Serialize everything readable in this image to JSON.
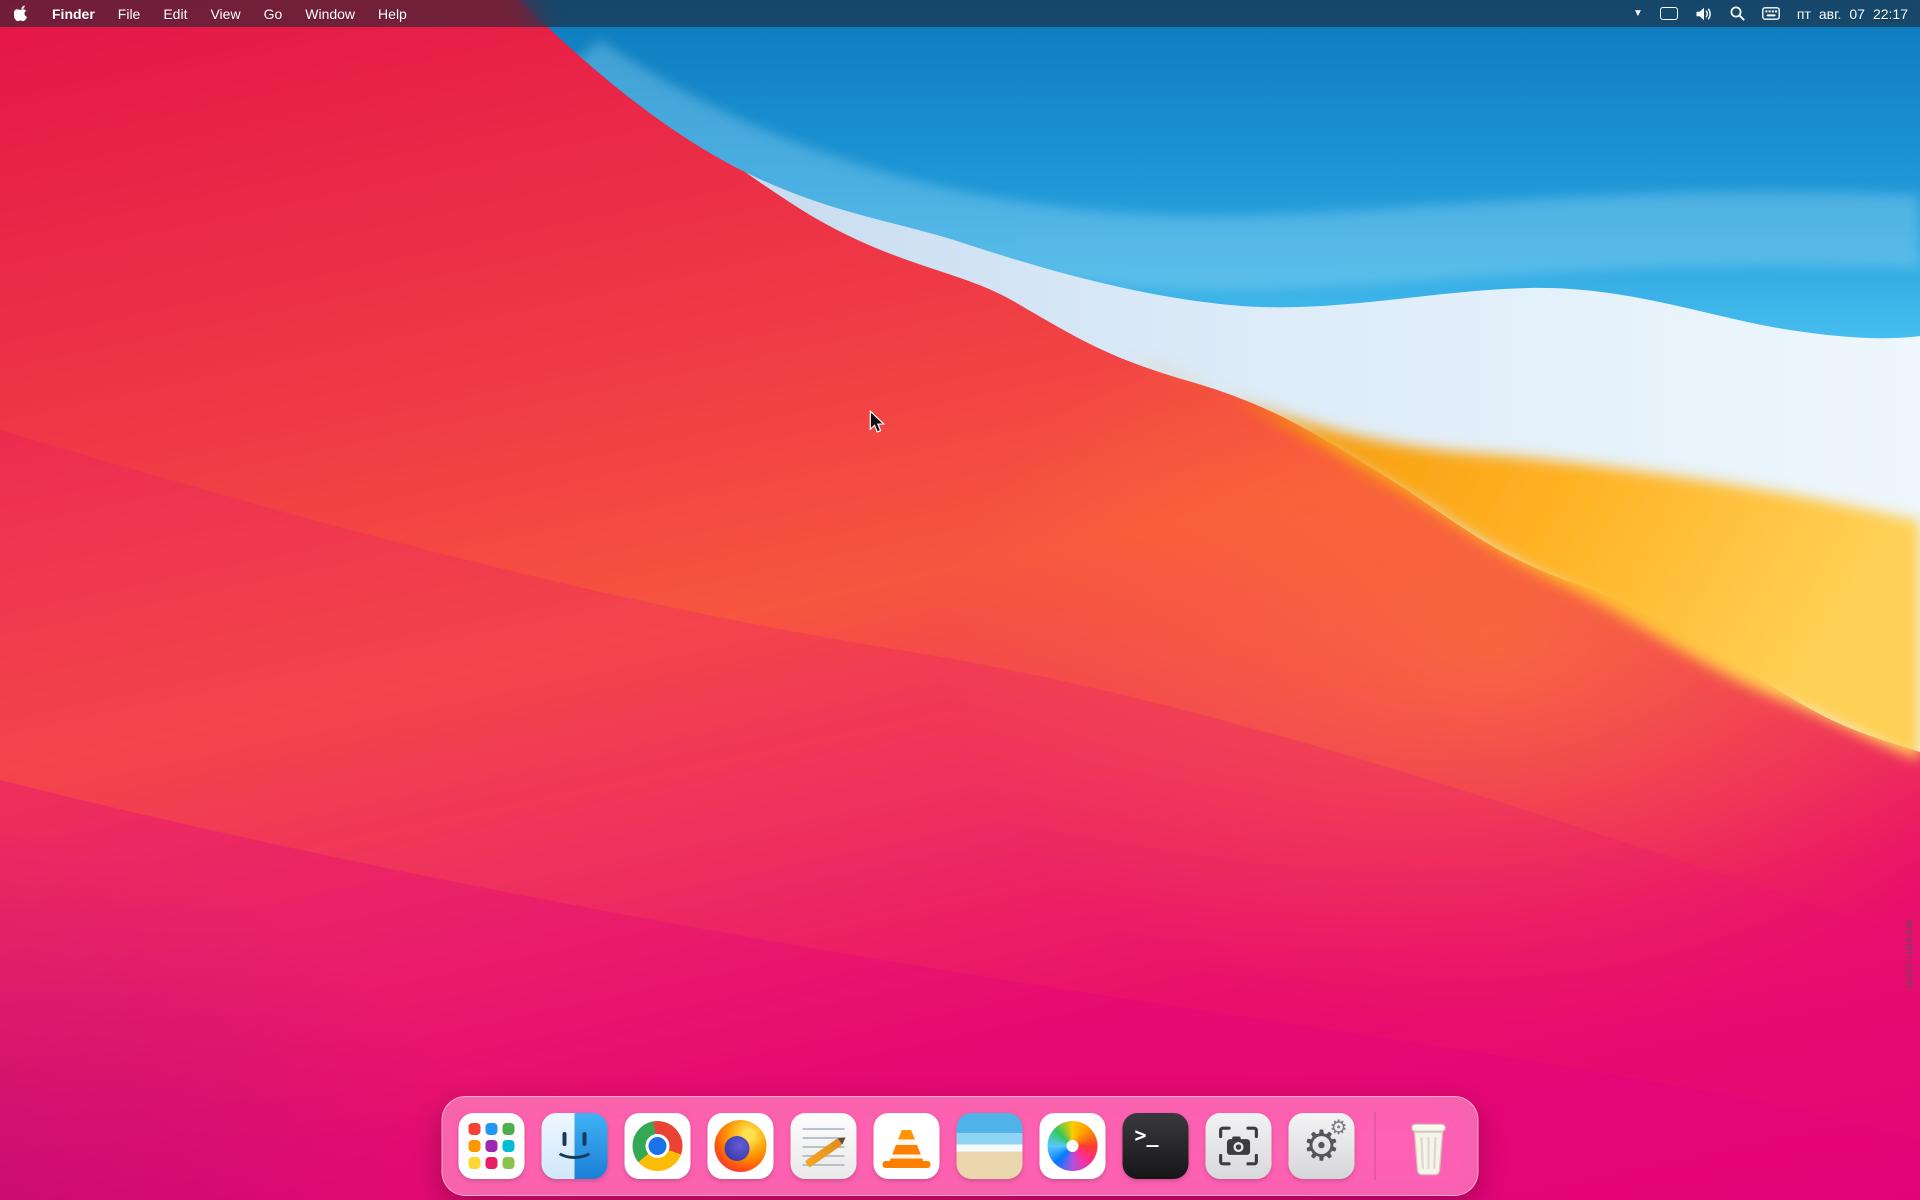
{
  "menubar": {
    "items": [
      {
        "label": "Finder"
      },
      {
        "label": "File"
      },
      {
        "label": "Edit"
      },
      {
        "label": "View"
      },
      {
        "label": "Go"
      },
      {
        "label": "Window"
      },
      {
        "label": "Help"
      }
    ],
    "status_icons": [
      "dropdown-arrow",
      "display",
      "volume",
      "search",
      "input-source"
    ],
    "clock": {
      "weekday": "пт",
      "month": "авг.",
      "day": "07",
      "time": "22:17"
    }
  },
  "dock": {
    "items": [
      "launchpad",
      "finder",
      "chrome",
      "firefox",
      "text-editor",
      "vlc",
      "image-viewer",
      "photos",
      "terminal",
      "screenshot",
      "settings",
      "trash"
    ],
    "terminal_glyph": ">_"
  },
  "watermark": "wsxdn.com",
  "colors": {
    "wallpaper_pink": "#e81549",
    "wallpaper_magenta": "#e20378",
    "wallpaper_blue": "#1f97d6",
    "wallpaper_orange": "#ffb020",
    "menubar_bg": "rgba(32,38,50,0.62)",
    "dock_bg": "rgba(255,255,255,0.38)"
  }
}
